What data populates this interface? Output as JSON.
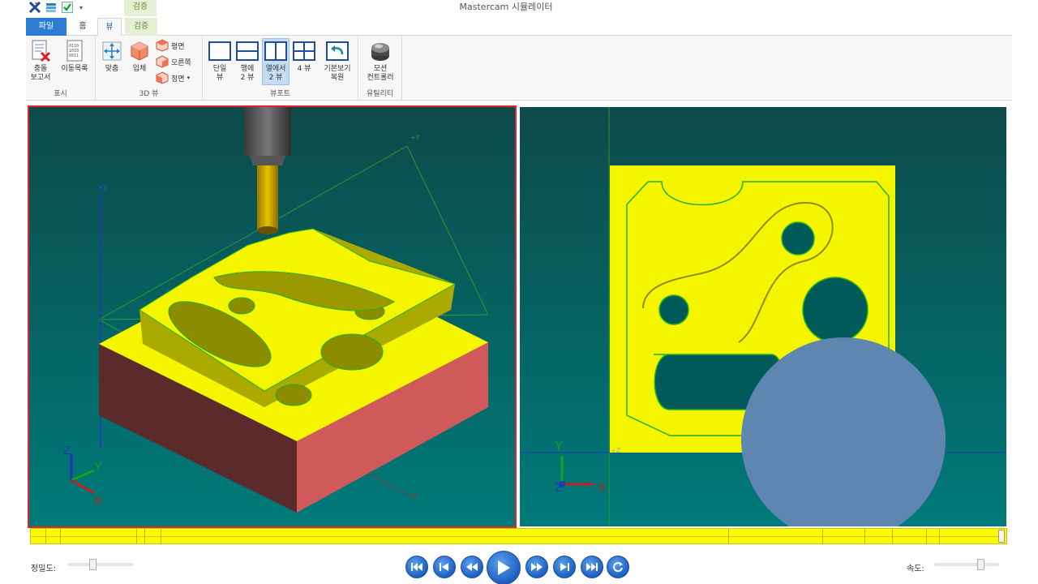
{
  "window": {
    "title": "Mastercam 시뮬레이터",
    "context_tab_header": "검증"
  },
  "tabs": {
    "file": "파일",
    "home": "홈",
    "view": "뷰",
    "verify": "검증"
  },
  "ribbon": {
    "display": {
      "collision_report": "충돌\n보고서",
      "move_list": "이동목록",
      "label": "표시"
    },
    "view3d": {
      "fit": "맞춤",
      "isometric": "입체",
      "top": "평면",
      "right": "오른쪽",
      "front": "정면",
      "label": "3D 뷰"
    },
    "viewport": {
      "single": "단일\n뷰",
      "row2": "행에\n2 뷰",
      "col2": "열에서\n2 뷰",
      "four": "4 뷰",
      "restore": "기본보기\n복원",
      "label": "뷰포트"
    },
    "utility": {
      "motion_controller": "모션\n컨트롤러",
      "label": "유틸리티"
    }
  },
  "viewport_left": {
    "triad": {
      "x": "X",
      "y": "Y",
      "z": "Z"
    },
    "axis_labels": {
      "plus_y": "+Y",
      "plus_z": "+Z",
      "minus_z": "-Z",
      "minus_x": "-X"
    }
  },
  "viewport_right": {
    "triad": {
      "x": "X",
      "y": "Y",
      "z": "Z"
    },
    "axis_labels": {
      "plus_z": "+Z"
    }
  },
  "colors": {
    "stock_top": "#f5f500",
    "stock_side": "#d05a5a",
    "viewport_bg_top": "#0d4a4a",
    "viewport_bg_bottom": "#007a7a",
    "tool_circle": "#5e86b0",
    "timeline": "#fffb00",
    "accent": "#2b7cd3"
  },
  "bottom": {
    "accuracy_label": "정밀도:",
    "speed_label": "속도:",
    "accuracy": 0.37,
    "speed": 0.75,
    "progress": 1.0
  },
  "playback": {
    "buttons": [
      "first-icon",
      "step-back-icon",
      "rewind-icon",
      "play-icon",
      "fast-forward-icon",
      "step-forward-icon",
      "last-icon",
      "loop-icon"
    ]
  }
}
